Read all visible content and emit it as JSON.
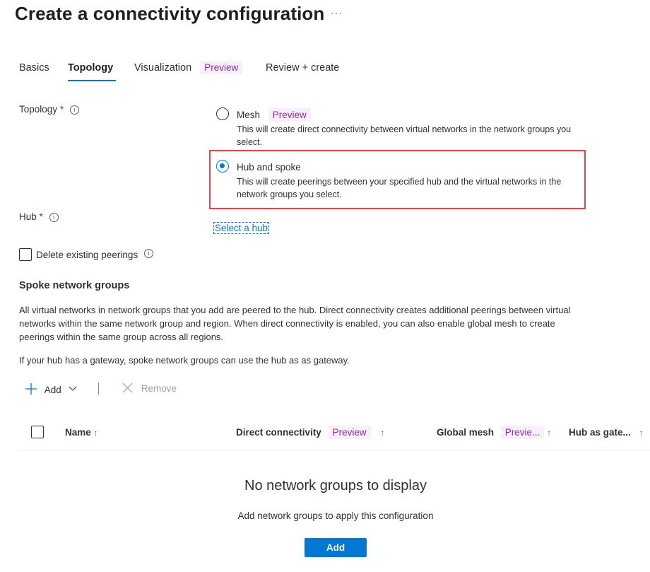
{
  "header": {
    "title": "Create a connectivity configuration",
    "more_label": "···"
  },
  "tabs": [
    {
      "label": "Basics",
      "active": false
    },
    {
      "label": "Topology",
      "active": true
    },
    {
      "label": "Visualization",
      "badge": "Preview",
      "active": false
    },
    {
      "label": "Review + create",
      "active": false
    }
  ],
  "form": {
    "topology": {
      "label": "Topology",
      "required_marker": "*",
      "info_glyph": "i",
      "options": [
        {
          "title": "Mesh",
          "badge": "Preview",
          "description": "This will create direct connectivity between virtual networks in the network groups you select.",
          "selected": false
        },
        {
          "title": "Hub and spoke",
          "description": "This will create peerings between your specified hub and the virtual networks in the network groups you select.",
          "selected": true
        }
      ]
    },
    "hub": {
      "label": "Hub",
      "required_marker": "*",
      "info_glyph": "i",
      "link_label": "Select a hub"
    },
    "delete_peerings": {
      "label": "Delete existing peerings",
      "checked": false,
      "info_glyph": "i"
    }
  },
  "spoke": {
    "title": "Spoke network groups",
    "description": "All virtual networks in network groups that you add are peered to the hub. Direct connectivity creates additional peerings between virtual networks within the same network group and region. When direct connectivity is enabled, you can also enable global mesh to create peerings within the same group across all regions.",
    "gateway_note": "If your hub has a gateway, spoke network groups can use the hub as as gateway.",
    "toolbar": {
      "add_label": "Add",
      "remove_label": "Remove"
    },
    "table": {
      "columns": [
        {
          "label": "Name",
          "sort": "↑"
        },
        {
          "label": "Direct connectivity",
          "badge": "Preview",
          "sort": "↑"
        },
        {
          "label": "Global mesh",
          "badge": "Previe...",
          "sort": "↑"
        },
        {
          "label": "Hub as gate...",
          "sort": "↑"
        }
      ],
      "rows": []
    },
    "empty_state": {
      "title": "No network groups to display",
      "subtitle": "Add network groups to apply this configuration",
      "button_label": "Add"
    }
  },
  "colors": {
    "accent": "#0078d4",
    "preview_badge_bg": "#f7f0fa",
    "preview_badge_text": "#8a2da5",
    "highlight_border": "#e8424b",
    "required": "#a4262c"
  }
}
